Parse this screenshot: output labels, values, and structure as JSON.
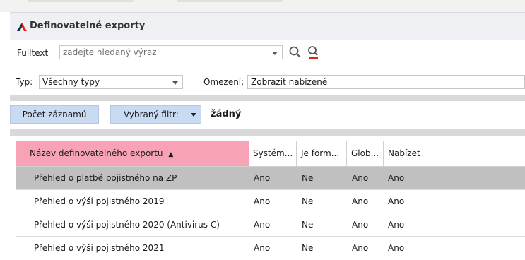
{
  "window": {
    "title": "Definovatelné exporty"
  },
  "search": {
    "label": "Fulltext",
    "placeholder": "zadejte hledaný výraz"
  },
  "filters": {
    "type_label": "Typ:",
    "type_value": "Všechny typy",
    "limit_label": "Omezení:",
    "limit_value": "Zobrazit nabízené"
  },
  "toolbar": {
    "count_button": "Počet záznamů",
    "filter_button": "Vybraný filtr:",
    "filter_value": "žádný"
  },
  "table": {
    "columns": [
      "Název definovatelného exportu",
      "Systém...",
      "Je form...",
      "Glob...",
      "Nabízet"
    ],
    "sort_indicator": "▲",
    "rows": [
      [
        "Přehled o platbě pojistného na ZP",
        "Ano",
        "Ne",
        "Ano",
        "Ano"
      ],
      [
        "Přehled o výši pojistného 2019",
        "Ano",
        "Ne",
        "Ano",
        "Ano"
      ],
      [
        "Přehled o výši pojistného 2020 (Antivirus C)",
        "Ano",
        "Ne",
        "Ano",
        "Ano"
      ],
      [
        "Přehled o výši pojistného 2021",
        "Ano",
        "Ne",
        "Ano",
        "Ano"
      ]
    ]
  },
  "colors": {
    "logo_red": "#e2231a",
    "logo_navy": "#1c2a4a",
    "sorted_header": "#f7a3b5",
    "selected_row": "#c0c0c0",
    "button_bg": "#c9dbf2"
  },
  "icons": [
    "logo-icon",
    "dropdown-arrow-icon",
    "search-icon",
    "clear-search-icon",
    "filter-dropdown-arrow-icon"
  ]
}
